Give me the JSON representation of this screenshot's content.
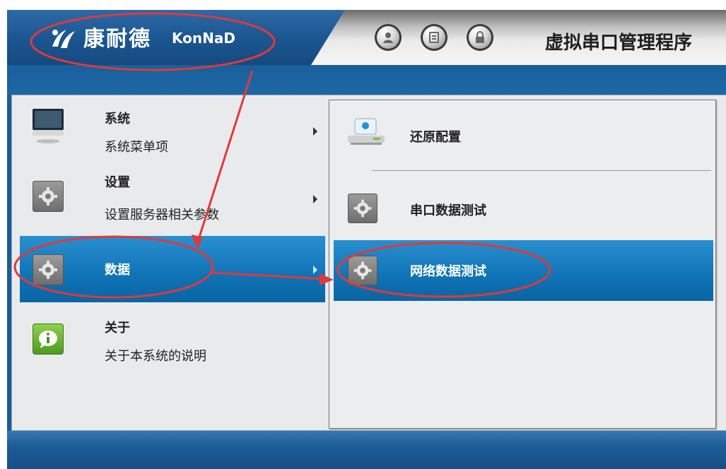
{
  "header": {
    "brand_cn": "康耐德",
    "brand_en": "KonNaD",
    "app_title": "虚拟串口管理程序",
    "icons": [
      "user-icon",
      "calculator-icon",
      "lock-icon"
    ]
  },
  "menu": {
    "items": [
      {
        "title": "系统",
        "subtitle": "系统菜单项",
        "icon": "monitor-icon",
        "has_submenu": true
      },
      {
        "title": "设置",
        "subtitle": "设置服务器相关参数",
        "icon": "gear-icon",
        "has_submenu": true
      },
      {
        "title": "数据",
        "subtitle": "",
        "icon": "gear-icon",
        "has_submenu": true,
        "selected": true
      },
      {
        "title": "关于",
        "subtitle": "关于本系统的说明",
        "icon": "info-icon",
        "has_submenu": false
      }
    ]
  },
  "submenu": {
    "items": [
      {
        "label": "还原配置",
        "icon": "drive-icon"
      },
      {
        "label": "串口数据测试",
        "icon": "gear-icon"
      },
      {
        "label": "网络数据测试",
        "icon": "gear-icon",
        "selected": true
      }
    ]
  },
  "colors": {
    "title_bar": "#1b5590",
    "selection": "#0f73b6",
    "annotation": "#e0393b"
  }
}
